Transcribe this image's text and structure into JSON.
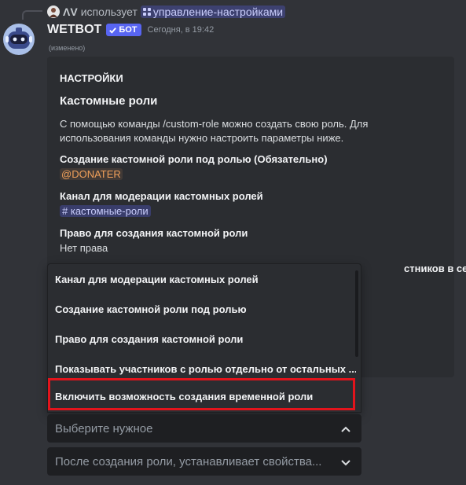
{
  "reply": {
    "user": "ΛV",
    "action": "использует",
    "command": "управление-настройками"
  },
  "author": {
    "name": "WETBOT",
    "badge": "БОТ",
    "timestamp": "Сегодня, в 19:42",
    "edited": "(изменено)"
  },
  "embed": {
    "author": "НАСТРОЙКИ",
    "title": "Кастомные роли",
    "description": "С помощью команды /custom-role можно создать свою роль. Для использования команды нужно настроить параметры ниже.",
    "fields": [
      {
        "name": "Создание кастомной роли под ролью (Обязательно)",
        "value": "@DONATER"
      },
      {
        "name": "Канал для модерации кастомных ролей",
        "value": "кастомные-роли"
      },
      {
        "name": "Право для создания кастомной роли",
        "value": "Нет права"
      }
    ],
    "partial_field_tail": "стников в сети"
  },
  "dropdown": {
    "options": [
      "Канал для модерации кастомных ролей",
      "Создание кастомной роли под ролью",
      "Право для создания кастомной роли",
      "Показывать участников с ролью отдельно от остальных ...",
      "Включить возможность создания временной роли"
    ]
  },
  "select1": {
    "placeholder": "Выберите нужное"
  },
  "select2": {
    "placeholder": "После создания роли, устанавливает свойства..."
  },
  "colors": {
    "background": "#313338",
    "embed": "#2b2d31",
    "blurple": "#5865f2",
    "role_mention": "#f0a05a",
    "highlight": "#e3141c"
  }
}
